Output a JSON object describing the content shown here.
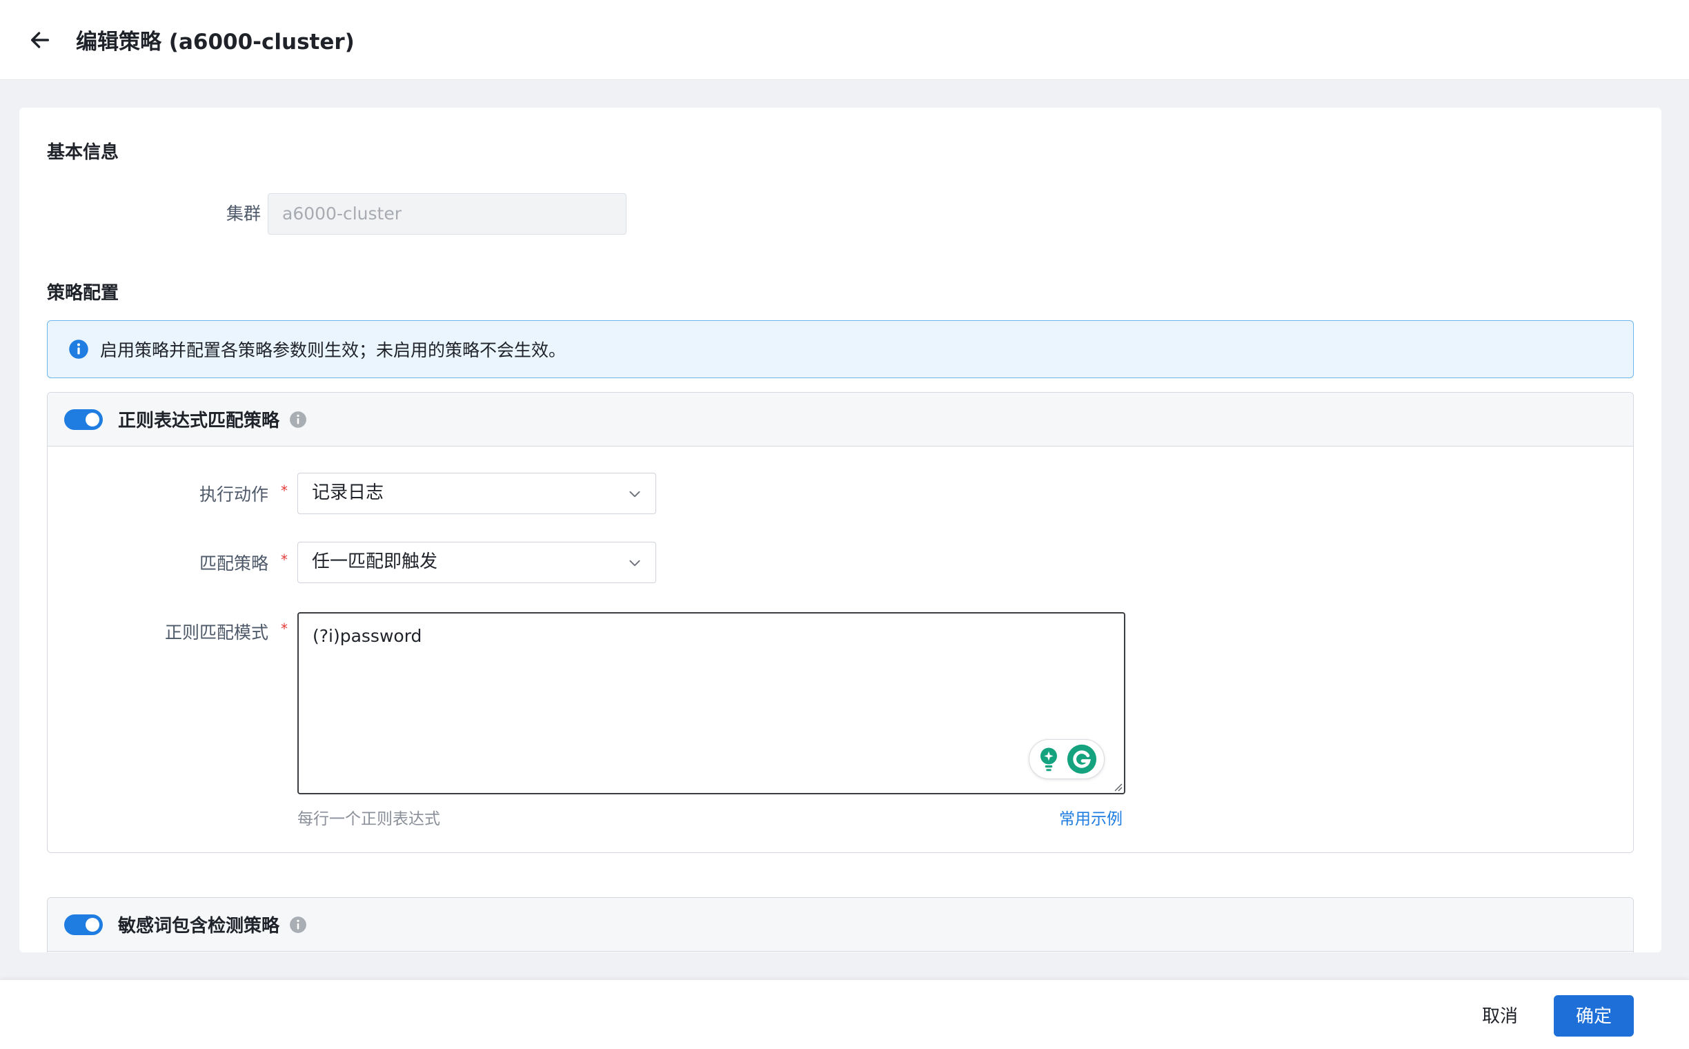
{
  "header": {
    "title": "编辑策略 (a6000-cluster)"
  },
  "basic_info": {
    "section_title": "基本信息",
    "cluster_label": "集群",
    "cluster_value": "a6000-cluster"
  },
  "policy_config": {
    "section_title": "策略配置",
    "alert_text": "启用策略并配置各策略参数则生效；未启用的策略不会生效。"
  },
  "regex_policy": {
    "title": "正则表达式匹配策略",
    "enabled": true,
    "action_label": "执行动作",
    "action_value": "记录日志",
    "match_label": "匹配策略",
    "match_value": "任一匹配即触发",
    "pattern_label": "正则匹配模式",
    "pattern_value": "(?i)password",
    "hint": "每行一个正则表达式",
    "examples_link": "常用示例"
  },
  "keyword_policy": {
    "title": "敏感词包含检测策略",
    "enabled": true
  },
  "footer": {
    "cancel_label": "取消",
    "confirm_label": "确定"
  },
  "colors": {
    "primary": "#1f6fd8",
    "toggle_on": "#1f7de1",
    "alert_bg": "#ebf5fd",
    "alert_border": "#6cb6ec",
    "required": "#e23b3b"
  }
}
